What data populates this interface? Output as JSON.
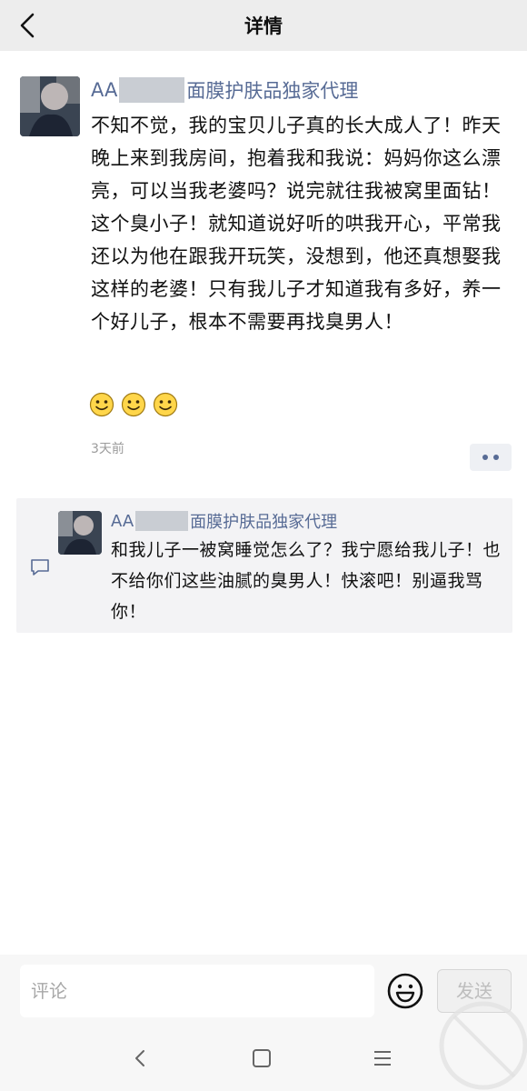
{
  "header": {
    "title": "详情"
  },
  "post": {
    "author_prefix": "AA",
    "author_suffix": "面膜护肤品独家代理",
    "body": "不知不觉，我的宝贝儿子真的长大成人了！昨天晚上来到我房间，抱着我和我说：妈妈你这么漂亮，可以当我老婆吗？说完就往我被窝里面钻！这个臭小子！就知道说好听的哄我开心，平常我还以为他在跟我开玩笑，没想到，他还真想娶我这样的老婆！只有我儿子才知道我有多好，养一个好儿子，根本不需要再找臭男人！",
    "emoji_icon": "smile-emoji-icon",
    "emoji_count": 3,
    "time": "3天前"
  },
  "comment": {
    "author_prefix": "AA",
    "author_suffix": "面膜护肤品独家代理",
    "text": "和我儿子一被窝睡觉怎么了？我宁愿给我儿子！也不给你们这些油腻的臭男人！快滚吧！别逼我骂你！"
  },
  "composer": {
    "placeholder": "评论",
    "send_label": "发送"
  },
  "icons": {
    "back": "chevron-left-icon",
    "more": "more-dots-icon",
    "comment": "comment-bubble-icon",
    "emoji": "smile-face-icon",
    "nav_back": "nav-back-icon",
    "nav_home": "nav-home-icon",
    "nav_menu": "nav-menu-icon"
  },
  "colors": {
    "link_blue": "#576b95",
    "topbar_bg": "#ededed",
    "comment_bg": "#f3f3f5"
  }
}
